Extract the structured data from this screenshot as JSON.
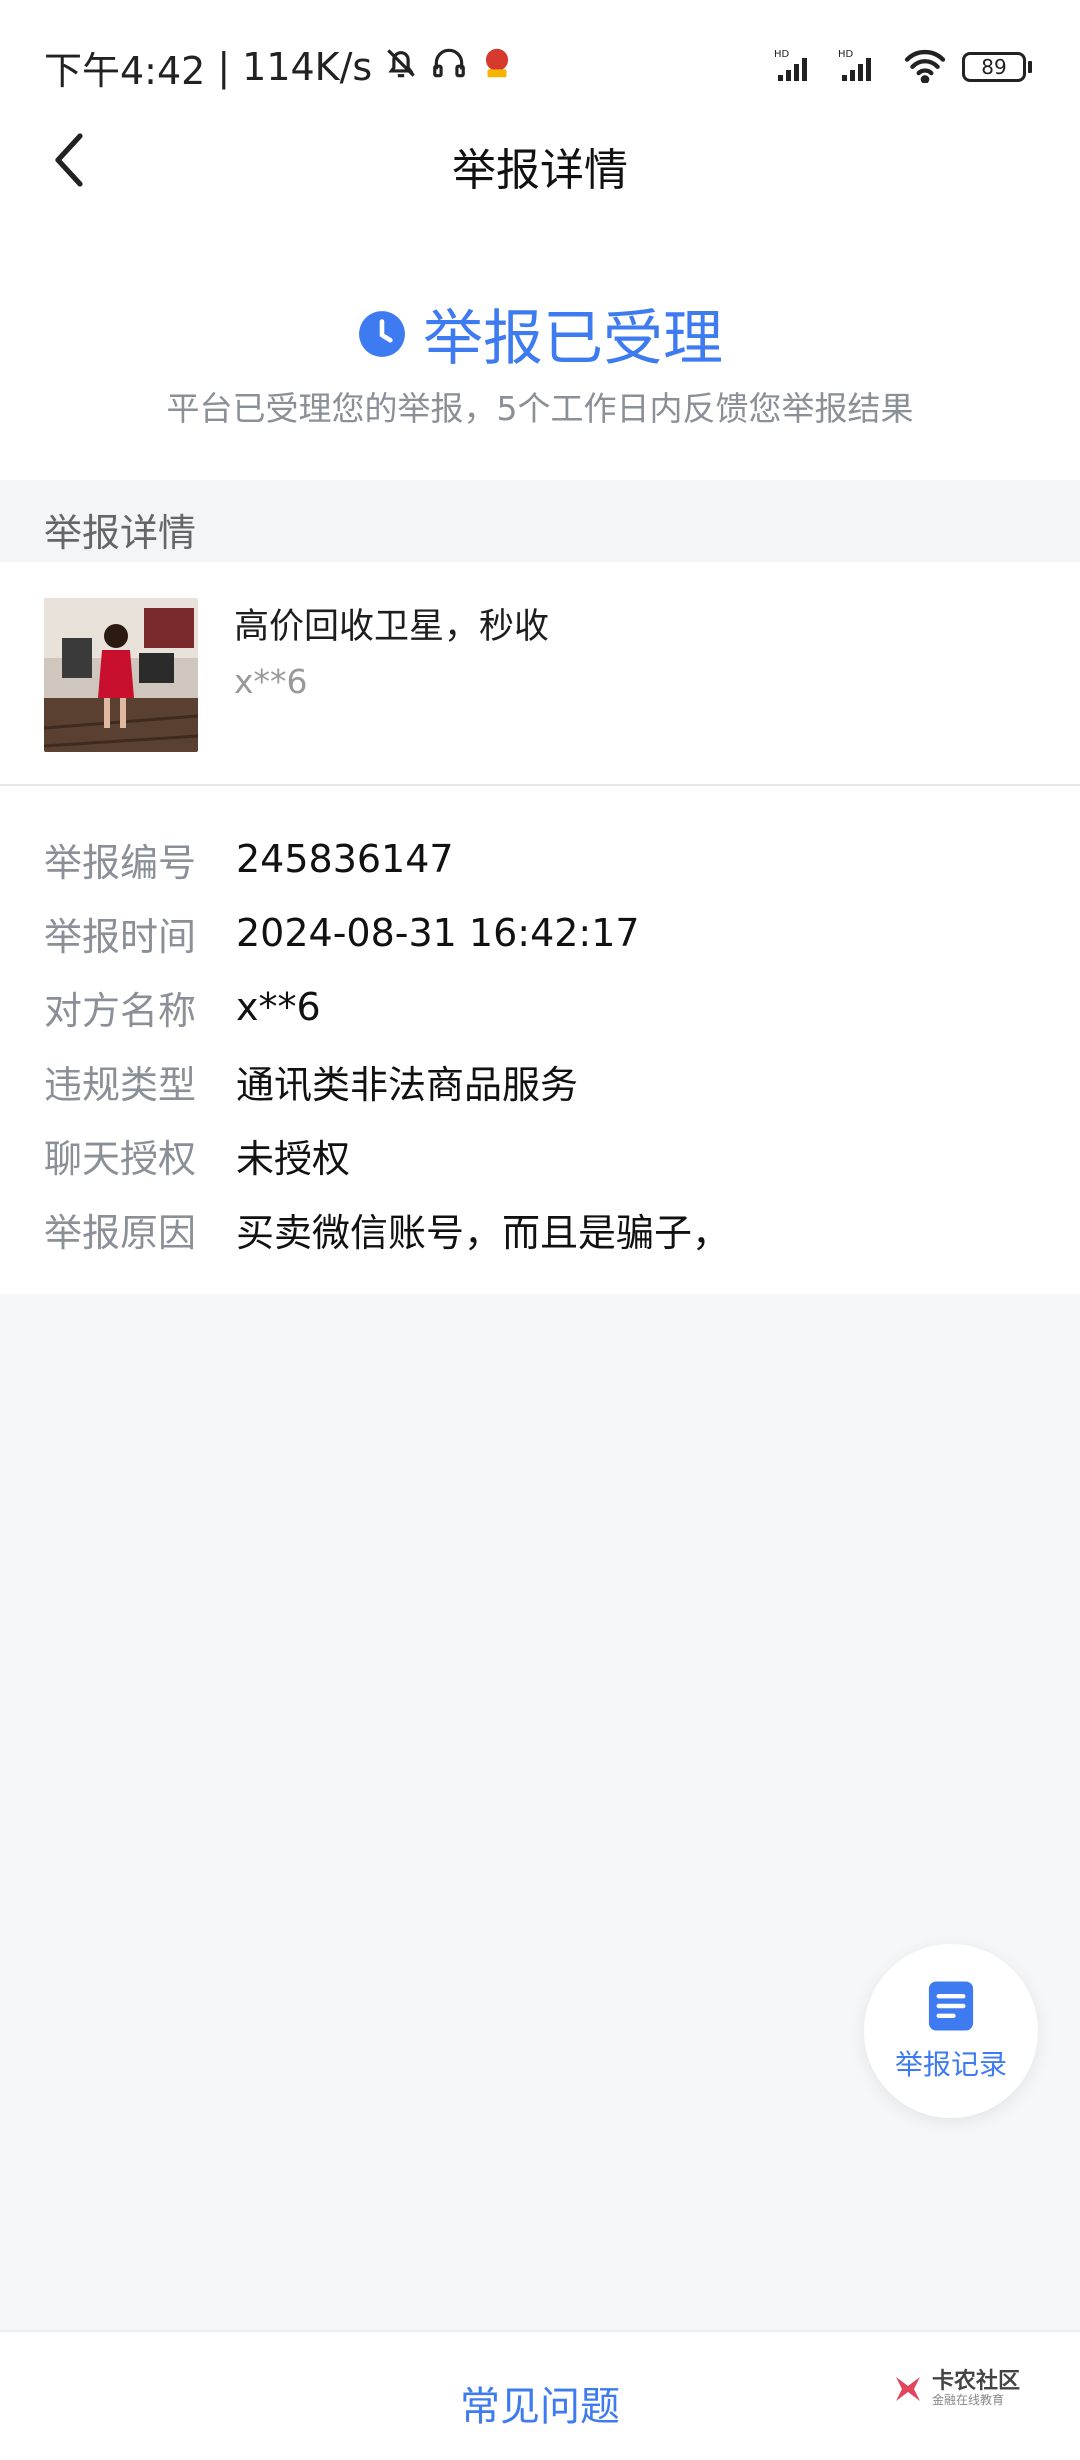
{
  "status_bar": {
    "time": "下午4:42",
    "separator": "|",
    "net_speed": "114K/s",
    "battery": "89",
    "signal_labels": [
      "HD",
      "HD"
    ]
  },
  "nav": {
    "title": "举报详情",
    "back_icon": "chevron-left-icon"
  },
  "status": {
    "icon": "clock-icon",
    "title": "举报已受理",
    "description": "平台已受理您的举报，5个工作日内反馈您举报结果",
    "color": "#3e7bf0"
  },
  "section": {
    "title": "举报详情"
  },
  "item": {
    "title": "高价回收卫星，秒收",
    "subtitle": "x**6"
  },
  "details": [
    {
      "label": "举报编号",
      "value": "245836147"
    },
    {
      "label": "举报时间",
      "value": "2024-08-31 16:42:17"
    },
    {
      "label": "对方名称",
      "value": "x**6"
    },
    {
      "label": "违规类型",
      "value": "通讯类非法商品服务"
    },
    {
      "label": "聊天授权",
      "value": "未授权"
    },
    {
      "label": "举报原因",
      "value": "买卖微信账号，而且是骗子，"
    }
  ],
  "float_button": {
    "icon": "document-icon",
    "label": "举报记录"
  },
  "bottom": {
    "faq_label": "常见问题"
  },
  "watermark": {
    "name": "卡农社区",
    "sub": "金融在线教育"
  }
}
